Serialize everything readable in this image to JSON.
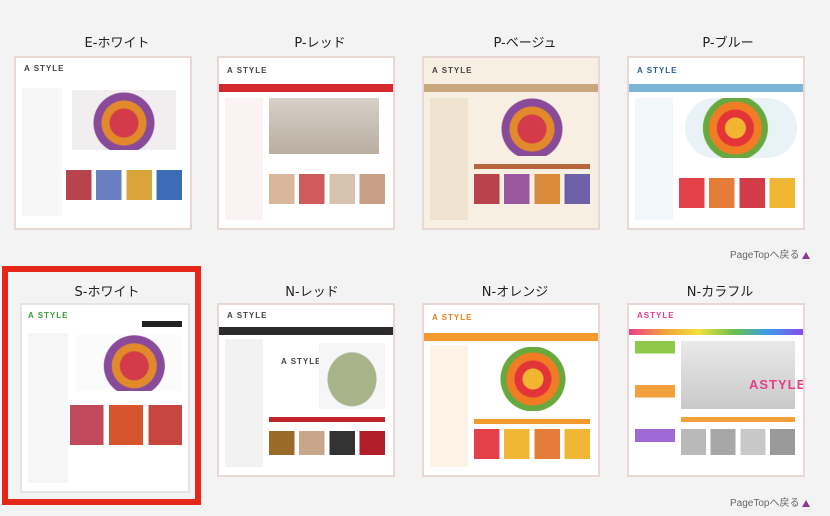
{
  "themes": [
    {
      "name": "E-ホワイト",
      "logo": "A STYLE"
    },
    {
      "name": "P-レッド",
      "logo": "A STYLE"
    },
    {
      "name": "P-ベージュ",
      "logo": "A STYLE"
    },
    {
      "name": "P-ブルー",
      "logo": "A STYLE"
    },
    {
      "name": "S-ホワイト",
      "logo": "A STYLE"
    },
    {
      "name": "N-レッド",
      "logo": "A STYLE",
      "hero_text": "A STYLE"
    },
    {
      "name": "N-オレンジ",
      "logo": "A STYLE"
    },
    {
      "name": "N-カラフル",
      "logo": "ASTYLE",
      "hero_text": "ASTYLE"
    }
  ],
  "back_to_top": "PageTopへ戻る",
  "selected_index": 4,
  "colors": {
    "highlight": "#e5271a",
    "triangle": "#8a3b8f"
  }
}
